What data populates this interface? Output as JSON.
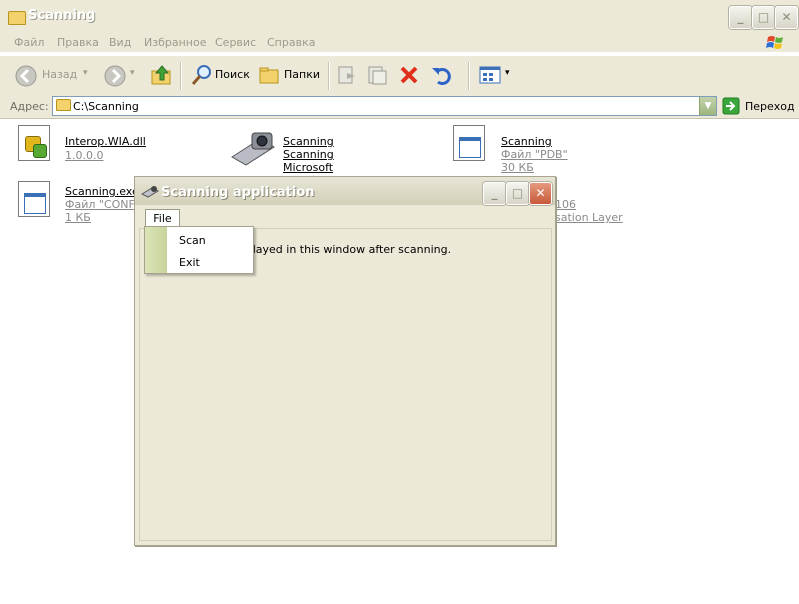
{
  "explorer": {
    "title": "Scanning",
    "menu": [
      "Файл",
      "Правка",
      "Вид",
      "Избранное",
      "Сервис",
      "Справка"
    ],
    "toolbar": {
      "back": "Назад",
      "search": "Поиск",
      "folders": "Папки"
    },
    "address": {
      "label": "Адрес:",
      "value": "C:\\Scanning",
      "go": "Переход"
    },
    "files": [
      {
        "name": "Interop.WIA.dll",
        "lines": [
          "1.0.0.0"
        ]
      },
      {
        "name": "Scanning",
        "lines": [
          "Scanning",
          "Microsoft"
        ]
      },
      {
        "name": "Scanning",
        "lines": [
          "Файл \"PDB\"",
          "30 КБ"
        ]
      },
      {
        "name": "Scanning.exe.",
        "lines": [
          "Файл \"CONFIG",
          "1 КБ"
        ]
      },
      {
        "name": "",
        "lines": [
          "106",
          "sation Layer"
        ]
      }
    ]
  },
  "app": {
    "title": "Scanning application",
    "menu_file": "File",
    "message": "splayed  in this window after scanning.",
    "dropdown": [
      "Scan",
      "Exit"
    ]
  },
  "window_buttons": {
    "minimize": "_",
    "maximize": "□",
    "close": "✕"
  }
}
